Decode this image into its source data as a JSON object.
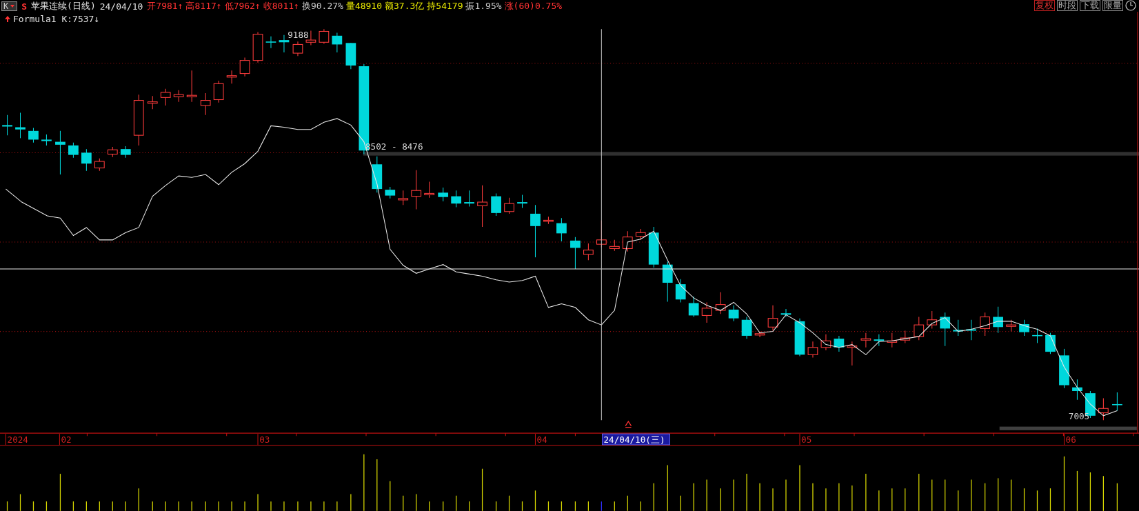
{
  "header": {
    "menu_button": "K",
    "series_mark": "S",
    "title": "苹果连续(日线)",
    "date": "24/04/10",
    "stats": [
      {
        "text": "开7981↑",
        "color": "#ff3232"
      },
      {
        "text": "高8117↑",
        "color": "#ff3232"
      },
      {
        "text": "低7962↑",
        "color": "#ff3232"
      },
      {
        "text": "收8011↑",
        "color": "#ff3232"
      },
      {
        "text": "换90.27%",
        "color": "#c8c8c8"
      },
      {
        "text": "量48910",
        "color": "#e8e800"
      },
      {
        "text": "额37.3亿",
        "color": "#e8e800"
      },
      {
        "text": "持54179",
        "color": "#e8e800"
      },
      {
        "text": "振1.95%",
        "color": "#c8c8c8"
      },
      {
        "text": "涨(60)0.75%",
        "color": "#ff3232"
      }
    ],
    "formula": "Formula1 K:7537↓"
  },
  "toolbar": [
    {
      "label": "复权",
      "selected": true
    },
    {
      "label": "时段",
      "selected": false
    },
    {
      "label": "下载",
      "selected": false
    },
    {
      "label": "限量",
      "selected": false
    }
  ],
  "chart": {
    "high_label": "9188",
    "range_label": "8502 - 8476",
    "low_label": "7005"
  },
  "time_axis": {
    "labels": [
      "2024",
      "02",
      "03",
      "04",
      "05",
      "06"
    ],
    "cursor_date": "24/04/10(三)"
  }
}
